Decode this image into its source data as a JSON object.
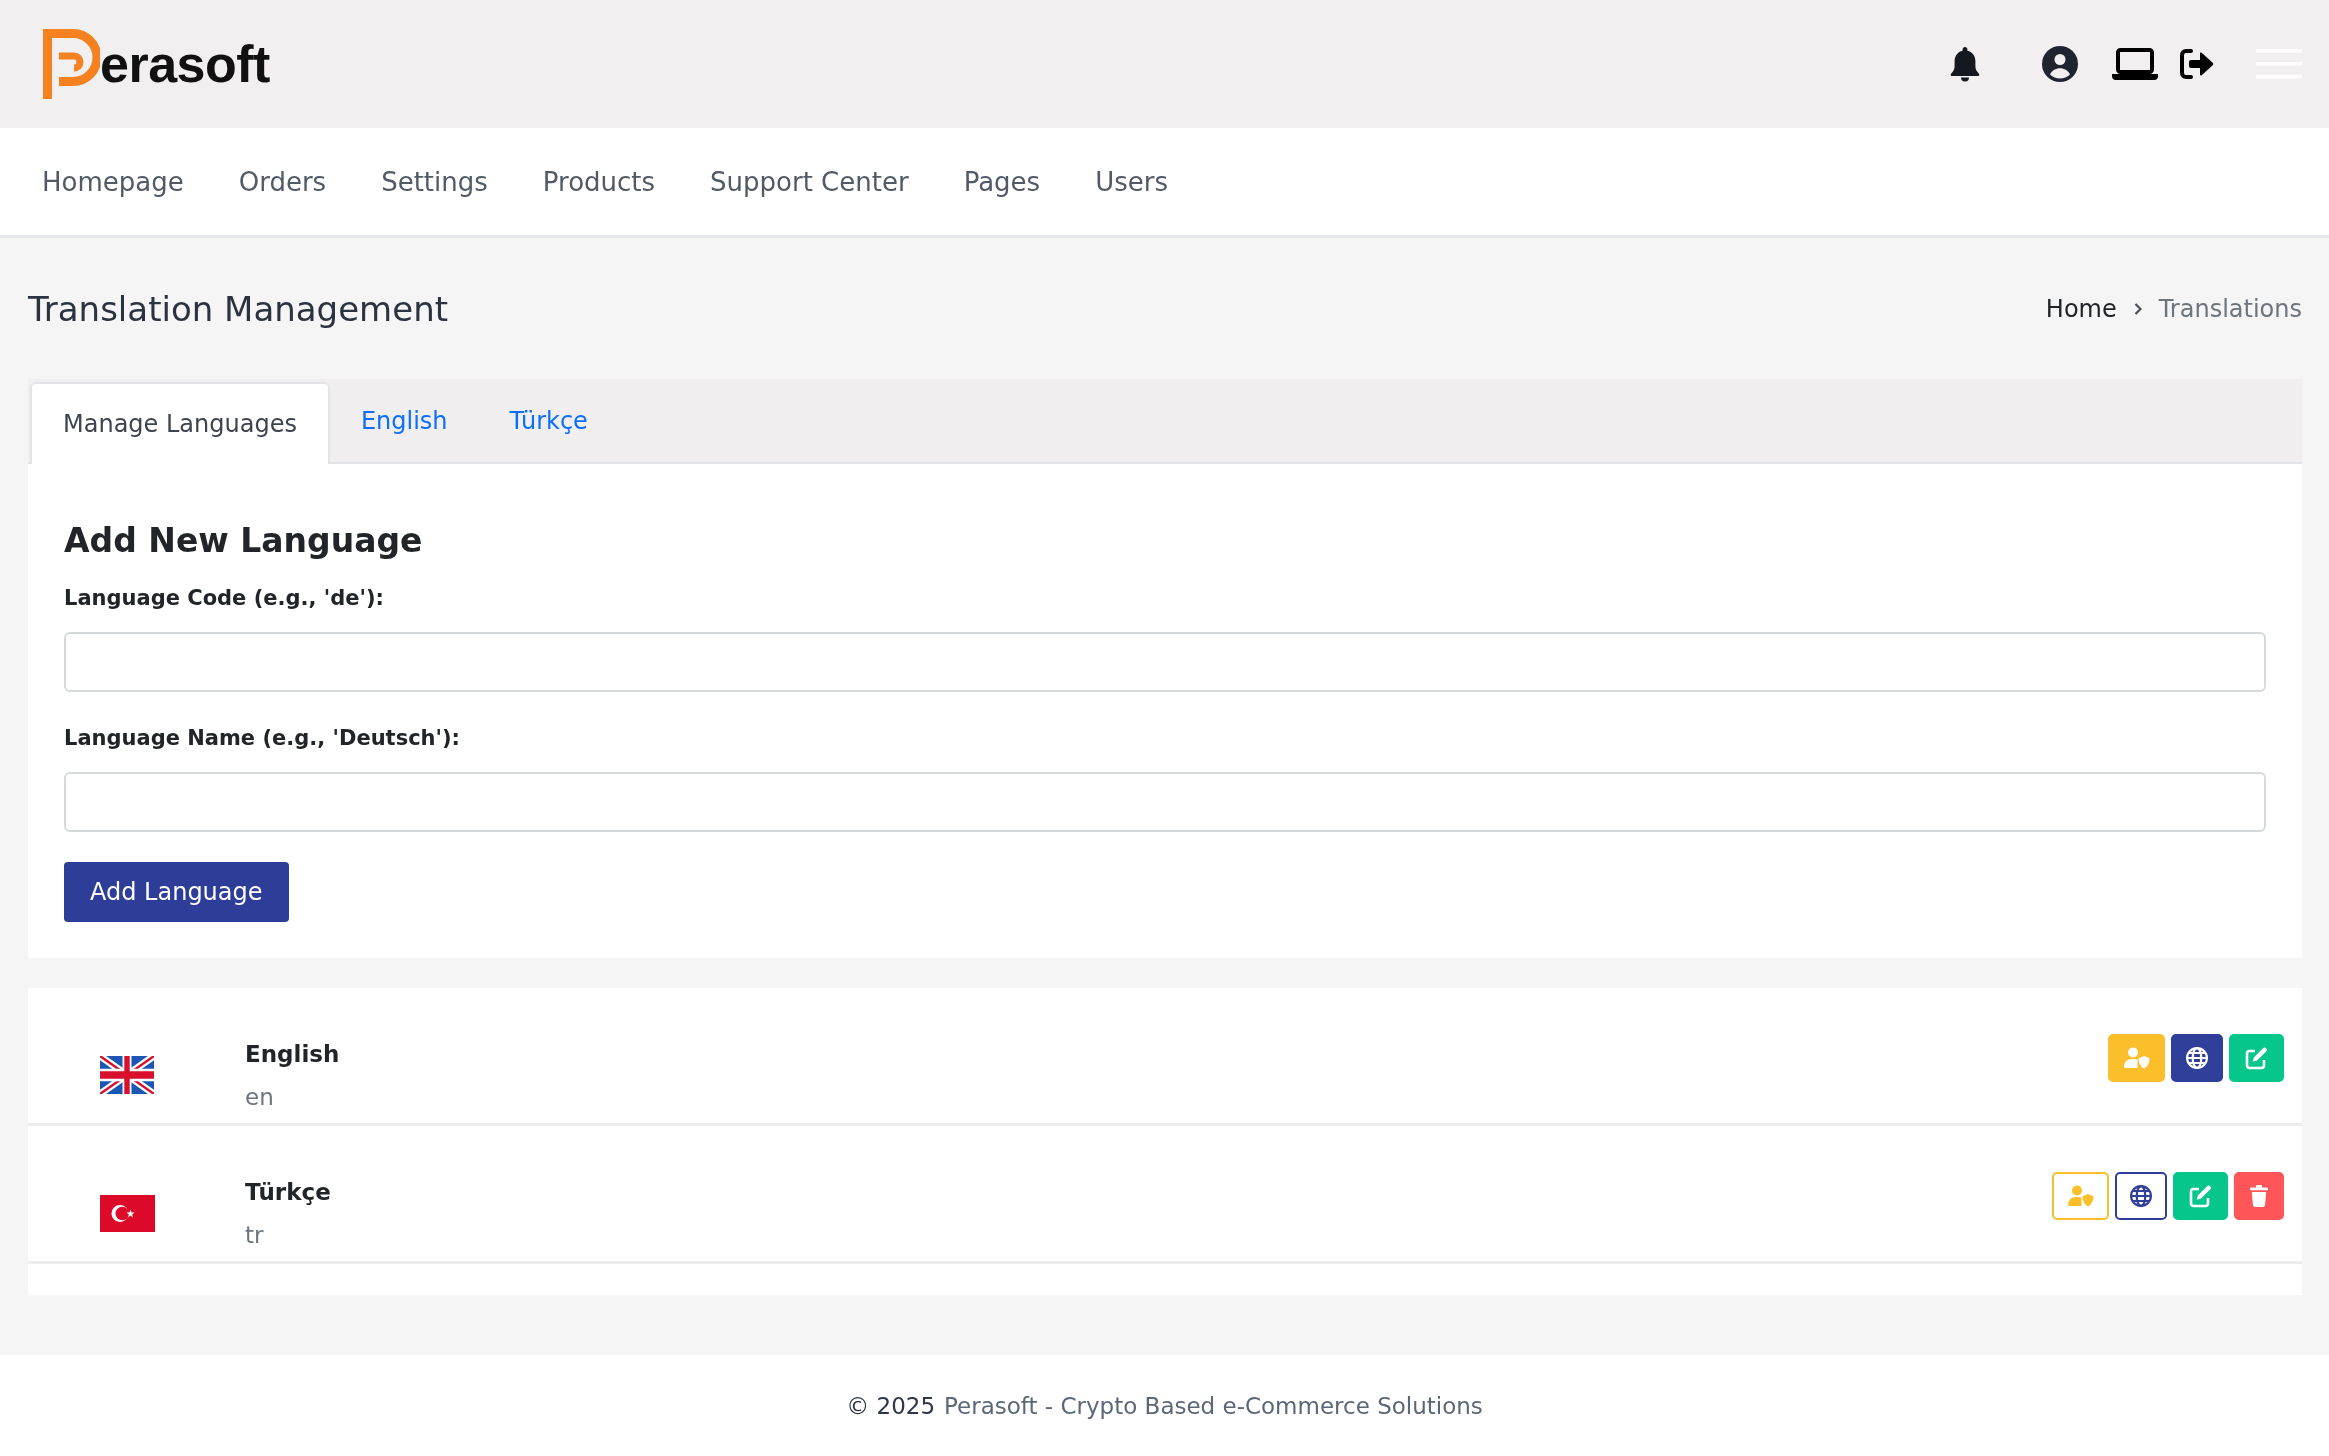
{
  "header": {
    "logo_text": "erasoft"
  },
  "nav": {
    "items": [
      {
        "label": "Homepage"
      },
      {
        "label": "Orders"
      },
      {
        "label": "Settings"
      },
      {
        "label": "Products"
      },
      {
        "label": "Support Center"
      },
      {
        "label": "Pages"
      },
      {
        "label": "Users"
      }
    ]
  },
  "page": {
    "title": "Translation Management",
    "breadcrumb": [
      {
        "label": "Home",
        "current": false
      },
      {
        "label": "Translations",
        "current": true
      }
    ]
  },
  "tabs": [
    {
      "label": "Manage Languages",
      "selected": true
    },
    {
      "label": "English",
      "selected": false
    },
    {
      "label": "Türkçe",
      "selected": false
    }
  ],
  "add_language_form": {
    "heading": "Add New Language",
    "fields": [
      {
        "label": "Language Code (e.g., 'de'):"
      },
      {
        "label": "Language Name (e.g., 'Deutsch'):"
      }
    ],
    "submit_button": "Add Language"
  },
  "languages": [
    {
      "kind": "gb",
      "name": "English",
      "code": "en",
      "actions": [
        {
          "kind": "permissions",
          "outline": false
        },
        {
          "kind": "translate",
          "outline": false
        },
        {
          "kind": "edit",
          "outline": false
        }
      ]
    },
    {
      "kind": "tr",
      "name": "Türkçe",
      "code": "tr",
      "actions": [
        {
          "kind": "permissions",
          "outline": true
        },
        {
          "kind": "translate",
          "outline": true
        },
        {
          "kind": "edit",
          "outline": false
        },
        {
          "kind": "delete",
          "outline": false
        }
      ]
    }
  ],
  "footer": {
    "copyright": "© 2025",
    "link": "Perasoft - Crypto Based e-Commerce Solutions"
  }
}
